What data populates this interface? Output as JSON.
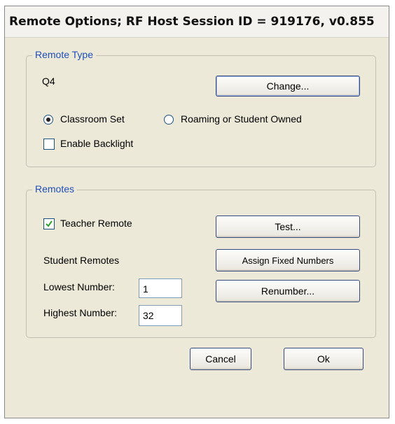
{
  "window": {
    "title": "Remote Options; RF Host Session ID = 919176, v0.855"
  },
  "remote_type": {
    "legend": "Remote Type",
    "current_type": "Q4",
    "change_button": "Change...",
    "options": [
      {
        "label": "Classroom Set",
        "selected": true
      },
      {
        "label": "Roaming or Student Owned",
        "selected": false
      }
    ],
    "enable_backlight": {
      "label": "Enable Backlight",
      "checked": false
    }
  },
  "remotes": {
    "legend": "Remotes",
    "teacher_remote": {
      "label": "Teacher Remote",
      "checked": true
    },
    "test_button": "Test...",
    "student_remotes_label": "Student Remotes",
    "assign_button": "Assign Fixed Numbers",
    "lowest_label": "Lowest Number:",
    "lowest_value": "1",
    "renumber_button": "Renumber...",
    "highest_label": "Highest Number:",
    "highest_value": "32"
  },
  "footer": {
    "cancel_button": "Cancel",
    "ok_button": "Ok"
  },
  "colors": {
    "dialog_bg": "#ece9d8",
    "legend_text": "#1f4fb8",
    "check_mark": "#2e9e2e"
  }
}
